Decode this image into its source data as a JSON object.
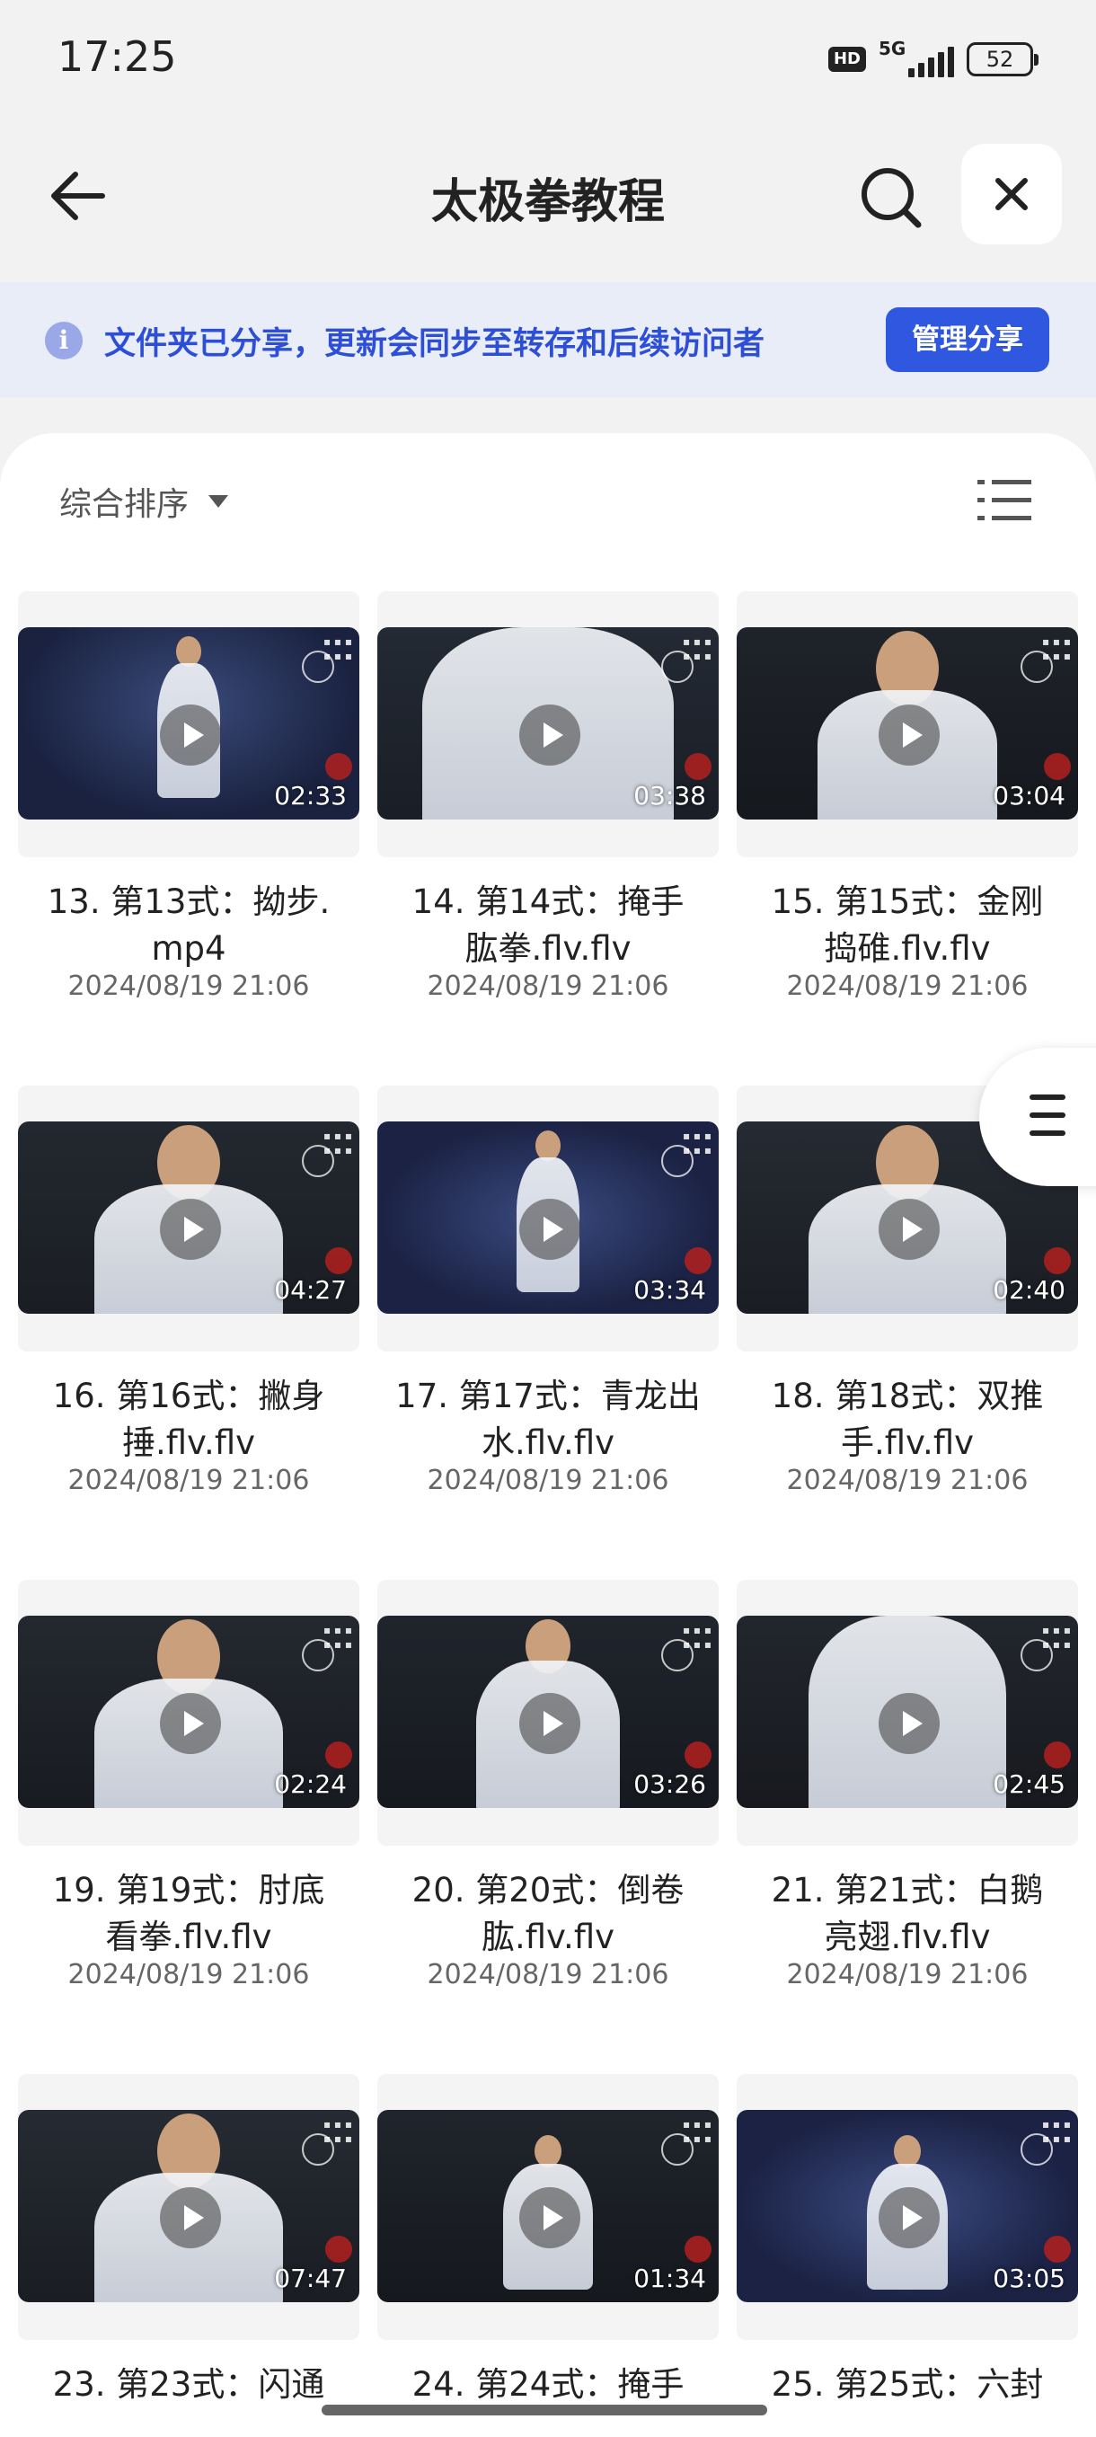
{
  "status_bar": {
    "time": "17:25",
    "hd": "HD",
    "network": "5G",
    "battery": "52"
  },
  "header": {
    "title": "太极拳教程",
    "back_icon": "arrow-left-icon",
    "search_icon": "search-icon",
    "close_icon": "close-icon"
  },
  "banner": {
    "text": "文件夹已分享，更新会同步至转存和后续访问者",
    "button_label": "管理分享",
    "accent_color": "#2f57e0"
  },
  "toolbar": {
    "sort_label": "综合排序"
  },
  "files": [
    {
      "name_line1": "13. 第13式：拗步.",
      "name_line2": "mp4",
      "date": "2024/08/19 21:06",
      "duration": "02:33"
    },
    {
      "name_line1": "14. 第14式：掩手",
      "name_line2": "肱拳.flv.flv",
      "date": "2024/08/19 21:06",
      "duration": "03:38"
    },
    {
      "name_line1": "15. 第15式：金刚",
      "name_line2": "捣碓.flv.flv",
      "date": "2024/08/19 21:06",
      "duration": "03:04"
    },
    {
      "name_line1": "16. 第16式：撇身",
      "name_line2": "捶.flv.flv",
      "date": "2024/08/19 21:06",
      "duration": "04:27"
    },
    {
      "name_line1": "17. 第17式：青龙出",
      "name_line2": "水.flv.flv",
      "date": "2024/08/19 21:06",
      "duration": "03:34"
    },
    {
      "name_line1": "18. 第18式：双推",
      "name_line2": "手.flv.flv",
      "date": "2024/08/19 21:06",
      "duration": "02:40"
    },
    {
      "name_line1": "19. 第19式：肘底",
      "name_line2": "看拳.flv.flv",
      "date": "2024/08/19 21:06",
      "duration": "02:24"
    },
    {
      "name_line1": "20. 第20式：倒卷",
      "name_line2": "肱.flv.flv",
      "date": "2024/08/19 21:06",
      "duration": "03:26"
    },
    {
      "name_line1": "21. 第21式：白鹅",
      "name_line2": "亮翅.flv.flv",
      "date": "2024/08/19 21:06",
      "duration": "02:45"
    },
    {
      "name_line1": "23. 第23式：闪通",
      "name_line2": "",
      "date": "",
      "duration": "07:47"
    },
    {
      "name_line1": "24. 第24式：掩手",
      "name_line2": "",
      "date": "",
      "duration": "01:34"
    },
    {
      "name_line1": "25. 第25式：六封",
      "name_line2": "",
      "date": "",
      "duration": "03:05"
    }
  ]
}
